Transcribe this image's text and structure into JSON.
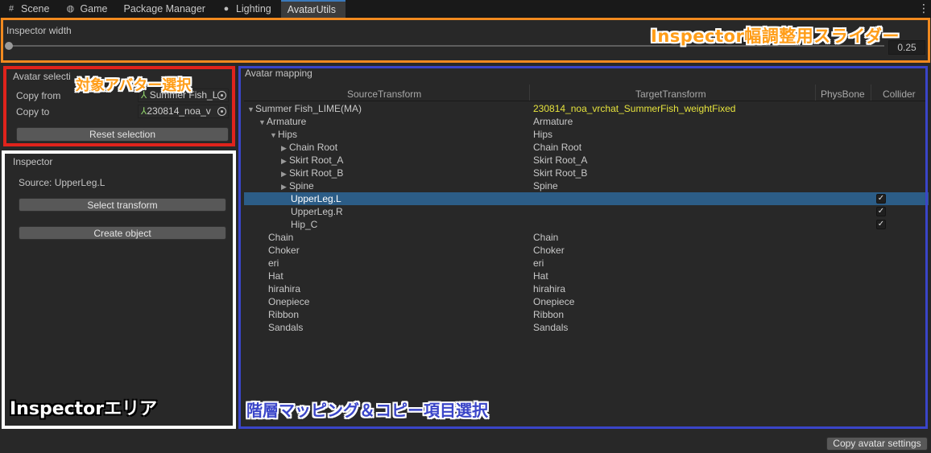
{
  "tabs": [
    {
      "label": "Scene",
      "icon": "grid-icon"
    },
    {
      "label": "Game",
      "icon": "gamepad-icon"
    },
    {
      "label": "Package Manager",
      "icon": ""
    },
    {
      "label": "Lighting",
      "icon": "bulb-icon"
    },
    {
      "label": "AvatarUtils",
      "icon": ""
    }
  ],
  "tab_menu": "⋮",
  "slider": {
    "label": "Inspector width",
    "value": "0.25"
  },
  "annotations": {
    "slider": "Inspector幅調整用スライダー",
    "avatar_select": "対象アバター選択",
    "inspector": "Inspectorエリア",
    "mapping": "階層マッピング＆コピー項目選択"
  },
  "avatar_selection": {
    "title": "Avatar selecti",
    "copy_from_label": "Copy from",
    "copy_from_value": "Summer Fish_L",
    "copy_to_label": "Copy to",
    "copy_to_value": "230814_noa_v",
    "reset_button": "Reset selection"
  },
  "inspector": {
    "title": "Inspector",
    "source": "Source: UpperLeg.L",
    "select_button": "Select transform",
    "create_button": "Create object"
  },
  "mapping": {
    "title": "Avatar mapping",
    "columns": [
      "SourceTransform",
      "TargetTransform",
      "PhysBone",
      "Collider"
    ],
    "rows": [
      {
        "src": "Summer Fish_LIME(MA)",
        "tgt": "230814_noa_vrchat_SummerFish_weightFixed",
        "depth": 0,
        "arrow": "▼",
        "highlight": true,
        "checked": false,
        "selected": false
      },
      {
        "src": "Armature",
        "tgt": "Armature",
        "depth": 1,
        "arrow": "▼",
        "highlight": false,
        "checked": false,
        "selected": false
      },
      {
        "src": "Hips",
        "tgt": "Hips",
        "depth": 2,
        "arrow": "▼",
        "highlight": false,
        "checked": false,
        "selected": false
      },
      {
        "src": "Chain Root",
        "tgt": "Chain Root",
        "depth": 3,
        "arrow": "▶",
        "highlight": false,
        "checked": false,
        "selected": false
      },
      {
        "src": "Skirt Root_A",
        "tgt": "Skirt Root_A",
        "depth": 3,
        "arrow": "▶",
        "highlight": false,
        "checked": false,
        "selected": false
      },
      {
        "src": "Skirt Root_B",
        "tgt": "Skirt Root_B",
        "depth": 3,
        "arrow": "▶",
        "highlight": false,
        "checked": false,
        "selected": false
      },
      {
        "src": "Spine",
        "tgt": "Spine",
        "depth": 3,
        "arrow": "▶",
        "highlight": false,
        "checked": false,
        "selected": false
      },
      {
        "src": "UpperLeg.L",
        "tgt": "",
        "depth": 3,
        "arrow": "",
        "highlight": false,
        "checked": true,
        "selected": true
      },
      {
        "src": "UpperLeg.R",
        "tgt": "",
        "depth": 3,
        "arrow": "",
        "highlight": false,
        "checked": true,
        "selected": false
      },
      {
        "src": "Hip_C",
        "tgt": "",
        "depth": 3,
        "arrow": "",
        "highlight": false,
        "checked": true,
        "selected": false
      },
      {
        "src": "Chain",
        "tgt": "Chain",
        "depth": 1,
        "arrow": "",
        "highlight": false,
        "checked": false,
        "selected": false
      },
      {
        "src": "Choker",
        "tgt": "Choker",
        "depth": 1,
        "arrow": "",
        "highlight": false,
        "checked": false,
        "selected": false
      },
      {
        "src": "eri",
        "tgt": "eri",
        "depth": 1,
        "arrow": "",
        "highlight": false,
        "checked": false,
        "selected": false
      },
      {
        "src": "Hat",
        "tgt": "Hat",
        "depth": 1,
        "arrow": "",
        "highlight": false,
        "checked": false,
        "selected": false
      },
      {
        "src": "hirahira",
        "tgt": "hirahira",
        "depth": 1,
        "arrow": "",
        "highlight": false,
        "checked": false,
        "selected": false
      },
      {
        "src": "Onepiece",
        "tgt": "Onepiece",
        "depth": 1,
        "arrow": "",
        "highlight": false,
        "checked": false,
        "selected": false
      },
      {
        "src": "Ribbon",
        "tgt": "Ribbon",
        "depth": 1,
        "arrow": "",
        "highlight": false,
        "checked": false,
        "selected": false
      },
      {
        "src": "Sandals",
        "tgt": "Sandals",
        "depth": 1,
        "arrow": "",
        "highlight": false,
        "checked": false,
        "selected": false
      }
    ]
  },
  "copy_button": "Copy avatar settings",
  "colors": {
    "accent": "#3a79bb",
    "selected_row": "#2c5d87",
    "highlight_text": "#e6e33d",
    "orange": "#f28a1f",
    "red": "#e0231c",
    "blue": "#3a45c8"
  }
}
